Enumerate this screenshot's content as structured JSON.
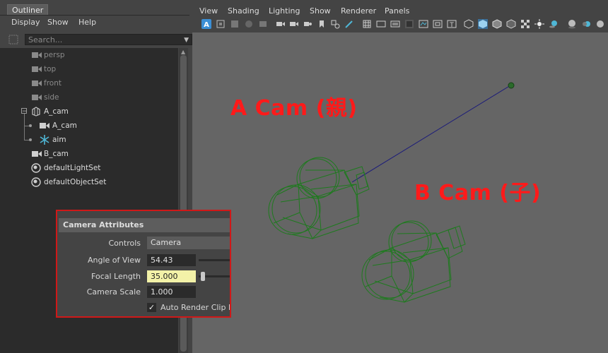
{
  "outliner": {
    "tab_label": "Outliner",
    "menu": [
      "Display",
      "Show",
      "Help"
    ],
    "search_placeholder": "Search...",
    "items": [
      {
        "label": "persp"
      },
      {
        "label": "top"
      },
      {
        "label": "front"
      },
      {
        "label": "side"
      },
      {
        "label": "A_cam",
        "expand_symbol": "−"
      },
      {
        "label": "A_cam"
      },
      {
        "label": "aim"
      },
      {
        "label": "B_cam"
      },
      {
        "label": "defaultLightSet"
      },
      {
        "label": "defaultObjectSet"
      }
    ]
  },
  "viewport": {
    "menu": [
      "View",
      "Shading",
      "Lighting",
      "Show",
      "Renderer",
      "Panels"
    ],
    "annotation_a": "A Cam (親)",
    "annotation_b": "B Cam (子)",
    "wire_color": "#1e7a1e",
    "aim_line_color": "#1c1c7a",
    "annotation_color": "#ff1a1a"
  },
  "camera_attributes": {
    "header": "Camera Attributes",
    "controls_label": "Controls",
    "controls_value": "Camera",
    "angle_label": "Angle of View",
    "angle_value": "54.43",
    "focal_label": "Focal Length",
    "focal_value": "35.000",
    "scale_label": "Camera Scale",
    "scale_value": "1.000",
    "auto_clip_label": "Auto Render Clip Pl",
    "auto_clip_checked": "✓"
  }
}
